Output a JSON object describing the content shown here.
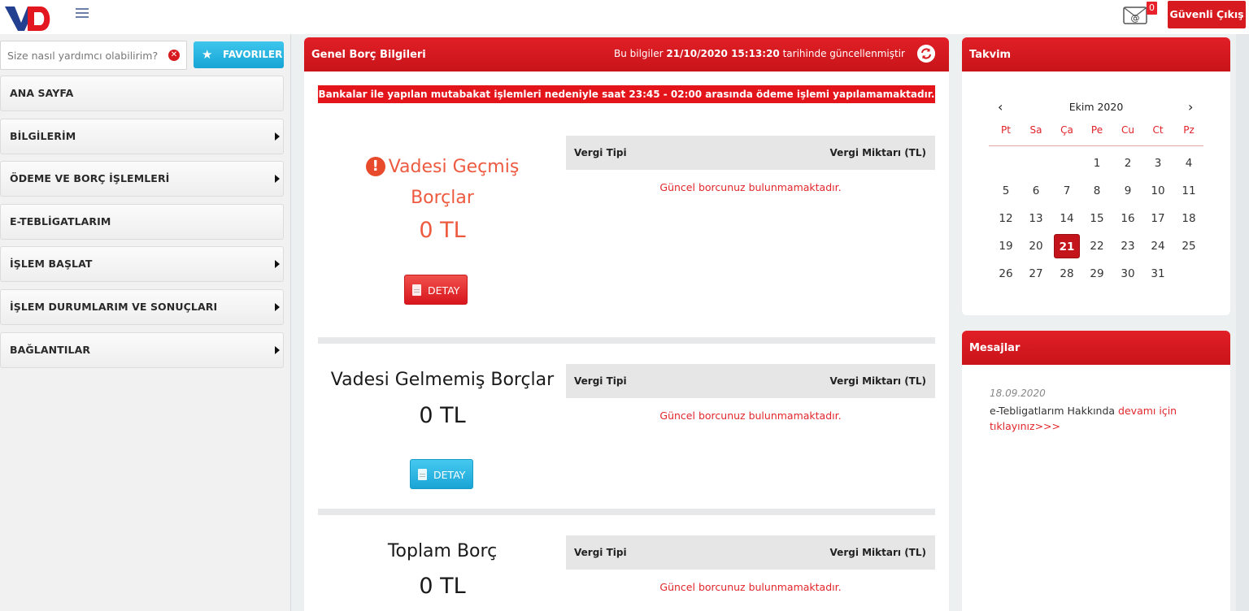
{
  "header": {
    "logo_alt": "VD",
    "mail_badge": "0",
    "logout_label": "Güvenli Çıkış"
  },
  "colors": {
    "brand_red": "#d71a1f",
    "accent_blue": "#16a5d6",
    "overdue_orange": "#ee5a3f"
  },
  "sidebar": {
    "search_placeholder": "Size nasıl yardımcı olabilirim?",
    "favorites_label": "FAVORILER",
    "items": [
      {
        "label": "ANA SAYFA",
        "has_submenu": false
      },
      {
        "label": "BİLGİLERİM",
        "has_submenu": true
      },
      {
        "label": "ÖDEME VE BORÇ İŞLEMLERİ",
        "has_submenu": true
      },
      {
        "label": "E-TEBLİGATLARIM",
        "has_submenu": false
      },
      {
        "label": "İŞLEM BAŞLAT",
        "has_submenu": true
      },
      {
        "label": "İŞLEM DURUMLARIM VE SONUÇLARI",
        "has_submenu": true
      },
      {
        "label": "BAĞLANTILAR",
        "has_submenu": true
      }
    ]
  },
  "main": {
    "title": "Genel Borç Bilgileri",
    "update_prefix": "Bu bilgiler ",
    "update_datetime": "21/10/2020 15:13:20",
    "update_suffix": " tarihinde güncellenmiştir",
    "alert": "Bankalar ile yapılan mutabakat işlemleri nedeniyle saat 23:45 - 02:00 arasında ödeme işlemi yapılamamaktadır.",
    "table_col_type": "Vergi Tipi",
    "table_col_amount": "Vergi Miktarı (TL)",
    "detail_label": "DETAY",
    "sections": [
      {
        "title_line1": "Vadesi Geçmiş",
        "title_line2": "Borçlar",
        "amount": "0 TL",
        "empty_text": "Güncel borcunuz bulunmamaktadır."
      },
      {
        "title": "Vadesi Gelmemiş Borçlar",
        "amount": "0 TL",
        "empty_text": "Güncel borcunuz bulunmamaktadır."
      },
      {
        "title": "Toplam Borç",
        "amount": "0 TL",
        "empty_text": "Güncel borcunuz bulunmamaktadır."
      }
    ]
  },
  "calendar": {
    "title": "Takvim",
    "month_label": "Ekim 2020",
    "prev_label": "‹",
    "next_label": "›",
    "weekdays": [
      "Pt",
      "Sa",
      "Ça",
      "Pe",
      "Cu",
      "Ct",
      "Pz"
    ],
    "first_weekday_index": 3,
    "days_in_month": 31,
    "selected_day": 21
  },
  "messages": {
    "title": "Mesajlar",
    "items": [
      {
        "date": "18.09.2020",
        "text": "e-Tebligatlarım Hakkında",
        "link": "devamı için tıklayınız>>>"
      }
    ]
  }
}
